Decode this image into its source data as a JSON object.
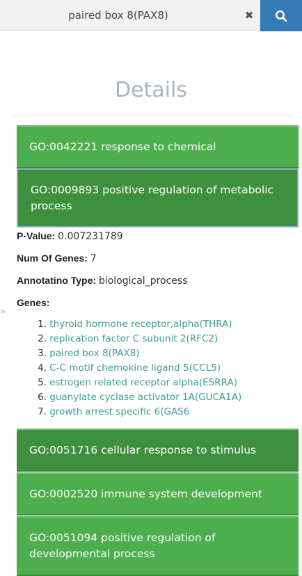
{
  "search": {
    "value": "paired box 8(PAX8)",
    "clear_label": "✖"
  },
  "details": {
    "title": "Details"
  },
  "panels_top": [
    {
      "label": "GO:0042221 response to chemical"
    },
    {
      "label": "GO:0009893 positive regulation of metabolic process"
    }
  ],
  "selected": {
    "pvalue_label": "P-Value:",
    "pvalue": "0.007231789",
    "num_genes_label": "Num Of Genes:",
    "num_genes": "7",
    "annotation_type_label": "Annotatino Type:",
    "annotation_type": "biological_process",
    "genes_label": "Genes:",
    "genes": [
      {
        "num": "1.",
        "name": "thyroid hormone receptor,alpha(THRA)"
      },
      {
        "num": "2.",
        "name": "replication factor C subunit 2(RFC2)"
      },
      {
        "num": "3.",
        "name": "paired box 8(PAX8)"
      },
      {
        "num": "4.",
        "name": "C-C motif chemokine ligand 5(CCL5)"
      },
      {
        "num": "5.",
        "name": "estrogen related receptor alpha(ESRRA)"
      },
      {
        "num": "6.",
        "name": "guanylate cyclase activator 1A(GUCA1A)"
      },
      {
        "num": "7.",
        "name": "growth arrest specific 6(GAS6"
      }
    ]
  },
  "panels_bottom": [
    {
      "label": "GO:0051716 cellular response to stimulus"
    },
    {
      "label": "GO:0002520 immune system development"
    },
    {
      "label": "GO:0051094 positive regulation of developmental process"
    }
  ],
  "icons": {
    "search": "search-icon",
    "clear": "close-icon",
    "toggle": "double-chevron-right-icon"
  },
  "colors": {
    "panel_green": "#4cae4c",
    "panel_green_dark": "#3e8f3e",
    "search_button": "#337ab7",
    "link_teal": "#3a9e96",
    "title_gray": "#a9b6bd"
  }
}
